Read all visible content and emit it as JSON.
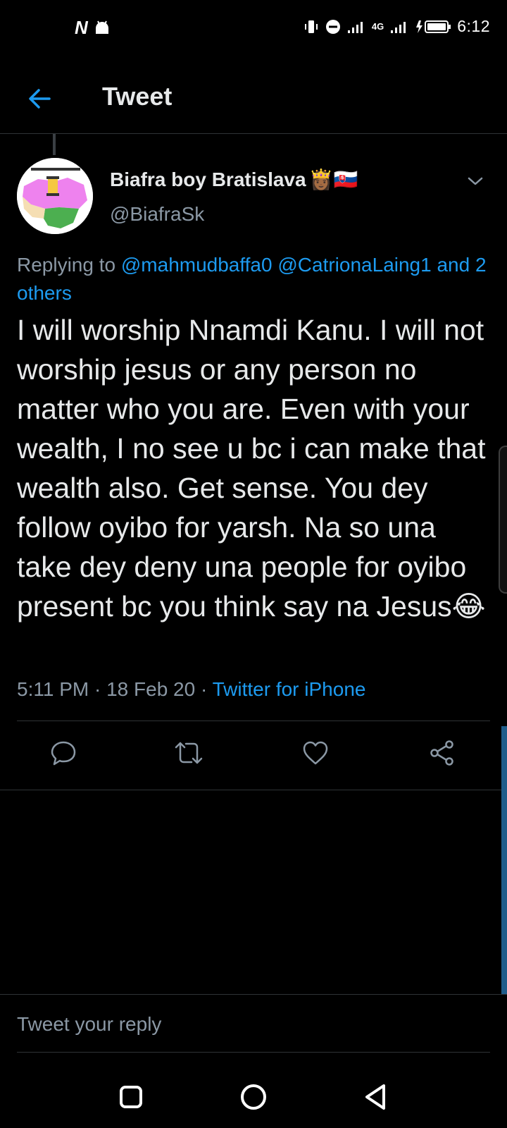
{
  "status_bar": {
    "left_icons": [
      "netflix-n-icon",
      "android-icon"
    ],
    "network": "4G",
    "time": "6:12"
  },
  "header": {
    "title": "Tweet"
  },
  "tweet": {
    "author_name": "Biafra boy Bratislava",
    "author_emojis": "👸🏾🇸🇰",
    "handle": "@BiafraSk",
    "replying_prefix": "Replying to",
    "mention_1": "@mahmudbaffa0",
    "mention_2": "@CatrionaLaing1",
    "mention_more": "and 2 others",
    "text": "I will worship Nnamdi Kanu. I will not worship jesus or any person no matter who you are. Even with your wealth, I no see u bc i can make that wealth also. Get sense. You dey follow oyibo for yarsh. Na so una take dey deny una people for oyibo present bc you think say na Jesus😂",
    "time": "5:11 PM",
    "date": "18 Feb 20",
    "separator": "·",
    "source": "Twitter for iPhone"
  },
  "reply": {
    "placeholder": "Tweet your reply"
  },
  "colors": {
    "accent": "#1d9bf0",
    "secondary_text": "#8b98a5",
    "background": "#000000"
  }
}
